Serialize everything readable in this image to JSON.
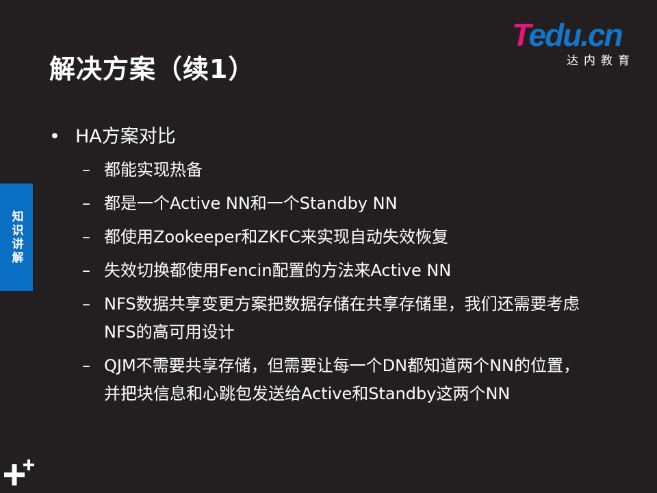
{
  "title": "解决方案（续1）",
  "logo": {
    "brand": "Tedu.cn",
    "subtitle": "达内教育"
  },
  "side_tab": "知识讲解",
  "bullet": "HA方案对比",
  "sub_items": [
    "都能实现热备",
    "都是一个Active NN和一个Standby NN",
    "都使用Zookeeper和ZKFC来实现自动失效恢复",
    "失效切换都使用Fencin配置的方法来Active  NN",
    "NFS数据共享变更方案把数据存储在共享存储里，我们还需要考虑NFS的高可用设计",
    "QJM不需要共享存储，但需要让每一个DN都知道两个NN的位置，并把块信息和心跳包发送给Active和Standby这两个NN"
  ],
  "colors": {
    "background": "#231f20",
    "accent": "#0a6fc2",
    "logo_pink": "#e8157e",
    "logo_blue": "#1476c8"
  }
}
